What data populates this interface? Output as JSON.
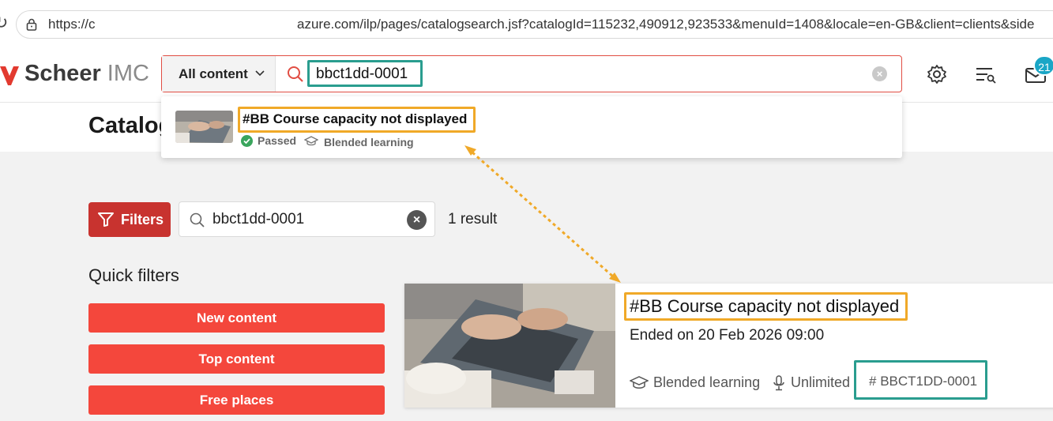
{
  "browser": {
    "url_left": "https://c",
    "url_right": "azure.com/ilp/pages/catalogsearch.jsf?catalogId=115232,490912,923533&menuId=1408&locale=en-GB&client=clients&side"
  },
  "header": {
    "brand_bold": "Scheer",
    "brand_light": "IMC",
    "scope_label": "All content",
    "search_value": "bbct1dd-0001",
    "notification_count": "21"
  },
  "suggestion": {
    "title": "#BB Course capacity not displayed",
    "status": "Passed",
    "type": "Blended learning"
  },
  "page": {
    "title": "Catalog",
    "filters_label": "Filters",
    "search_value": "bbct1dd-0001",
    "result_count": "1 result",
    "quick_filters_title": "Quick filters",
    "quick_filters": [
      "New content",
      "Top content",
      "Free places"
    ]
  },
  "result": {
    "title": "#BB Course capacity not displayed",
    "date": "Ended on 20 Feb 2026 09:00",
    "type": "Blended learning",
    "capacity": "Unlimited",
    "id": "BBCT1DD-0001"
  },
  "colors": {
    "accent_red": "#f4473c",
    "filters_red": "#c8332f",
    "highlight_orange": "#f0a928",
    "highlight_teal": "#2a9d8f",
    "badge_blue": "#1aa6c6"
  }
}
